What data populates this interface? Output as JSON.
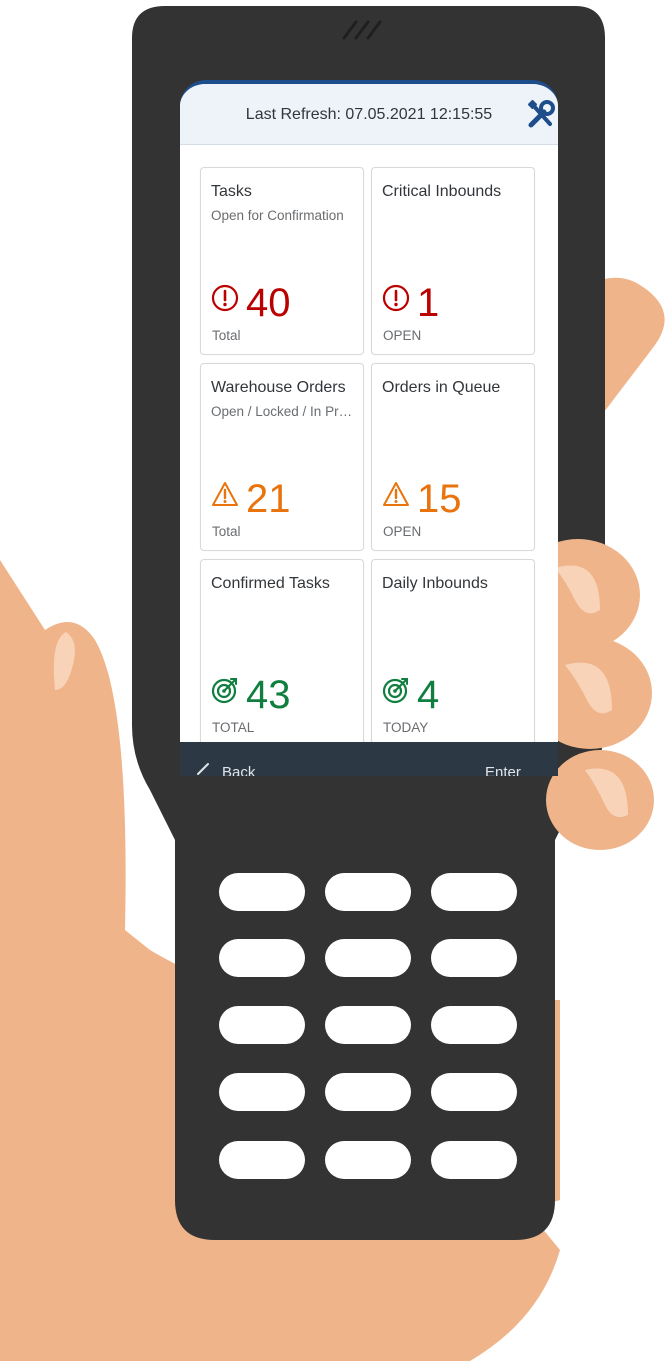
{
  "header": {
    "last_refresh": "Last Refresh: 07.05.2021 12:15:55"
  },
  "tiles": [
    {
      "title": "Tasks",
      "subtitle": "Open for Confirmation",
      "icon": "alert-circle-icon",
      "value": "40",
      "unit": "Total",
      "status_color": "#bb0000"
    },
    {
      "title": "Critical Inbounds",
      "subtitle": "",
      "icon": "alert-circle-icon",
      "value": "1",
      "unit": "OPEN",
      "status_color": "#bb0000"
    },
    {
      "title": "Warehouse Orders",
      "subtitle": "Open / Locked / In Pro...",
      "icon": "warning-triangle-icon",
      "value": "21",
      "unit": "Total",
      "status_color": "#e9730c"
    },
    {
      "title": "Orders in Queue",
      "subtitle": "",
      "icon": "warning-triangle-icon",
      "value": "15",
      "unit": "OPEN",
      "status_color": "#e9730c"
    },
    {
      "title": "Confirmed Tasks",
      "subtitle": "",
      "icon": "target-icon",
      "value": "43",
      "unit": "TOTAL",
      "status_color": "#107e3e"
    },
    {
      "title": "Daily Inbounds",
      "subtitle": "",
      "icon": "target-icon",
      "value": "4",
      "unit": "TODAY",
      "status_color": "#107e3e"
    }
  ],
  "footer": {
    "back_label": "Back",
    "enter_label": "Enter"
  },
  "colors": {
    "device_body": "#333333",
    "skin": "#f0b48a",
    "header_bg": "#edf3f8",
    "nav_bg": "#2c3843",
    "brand_blue": "#1e4d8c"
  }
}
